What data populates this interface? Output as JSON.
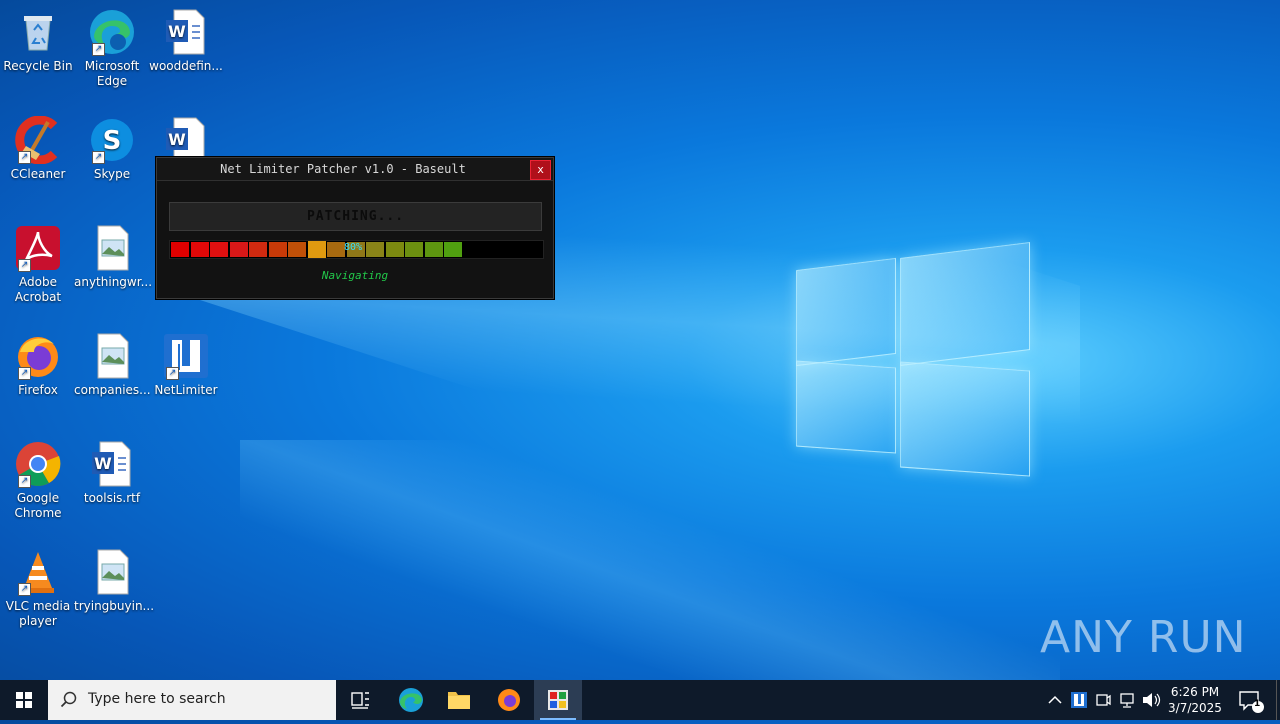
{
  "desktop": {
    "icons": [
      {
        "label": "Recycle Bin",
        "icon": "recycle-bin-icon"
      },
      {
        "label": "Microsoft Edge",
        "icon": "edge-icon"
      },
      {
        "label": "wooddefin...",
        "icon": "word-document-icon"
      },
      {
        "label": "CCleaner",
        "icon": "ccleaner-icon"
      },
      {
        "label": "Skype",
        "icon": "skype-icon"
      },
      {
        "label": "Adobe Acrobat",
        "icon": "acrobat-icon"
      },
      {
        "label": "anythingwr...",
        "icon": "image-file-icon"
      },
      {
        "label": "Firefox",
        "icon": "firefox-icon"
      },
      {
        "label": "companies...",
        "icon": "image-file-icon"
      },
      {
        "label": "NetLimiter",
        "icon": "netlimiter-icon"
      },
      {
        "label": "Google Chrome",
        "icon": "chrome-icon"
      },
      {
        "label": "toolsis.rtf",
        "icon": "word-document-icon"
      },
      {
        "label": "VLC media player",
        "icon": "vlc-icon"
      },
      {
        "label": "tryingbuyin...",
        "icon": "image-file-icon"
      }
    ]
  },
  "patcher": {
    "title": "Net Limiter Patcher v1.0 - Baseult",
    "close_label": "x",
    "status": "PATCHING...",
    "progress_label": "80%",
    "progress": 0.8,
    "message": "Navigating"
  },
  "taskbar": {
    "search_placeholder": "Type here to search",
    "time": "6:26 PM",
    "date": "3/7/2025",
    "notification_count": "1"
  },
  "watermark": "ANY RUN",
  "colors": {
    "taskbar": "#0e1a2a",
    "patcher_bg": "#121212",
    "close": "#b0101a",
    "message": "#22c84a",
    "percent": "#34e0ff"
  }
}
